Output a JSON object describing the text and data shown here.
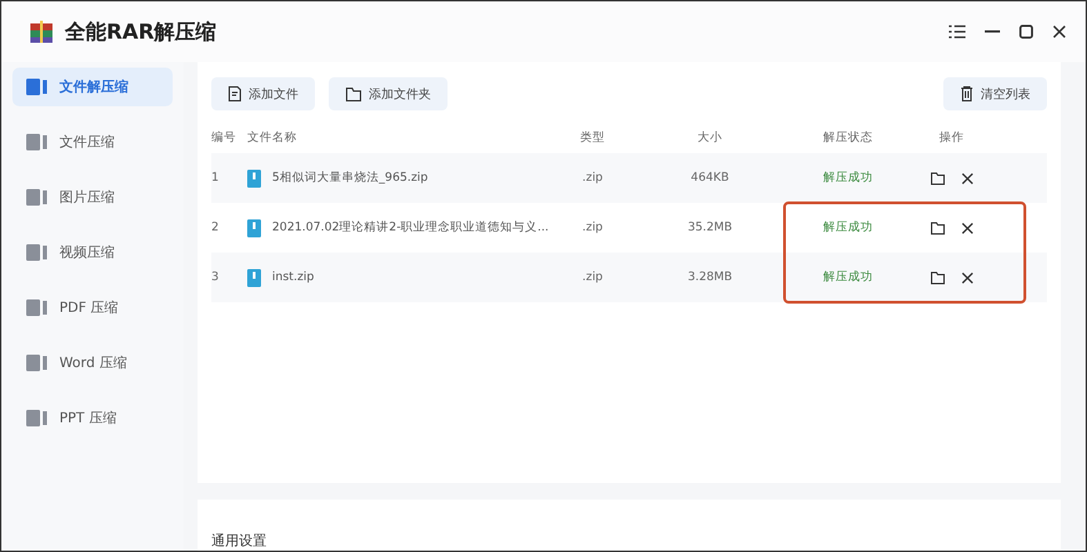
{
  "window": {
    "title": "全能RAR解压缩"
  },
  "sidebar": {
    "items": [
      {
        "label": "文件解压缩",
        "selected": true
      },
      {
        "label": "文件压缩",
        "selected": false
      },
      {
        "label": "图片压缩",
        "selected": false
      },
      {
        "label": "视频压缩",
        "selected": false
      },
      {
        "label": "PDF 压缩",
        "selected": false
      },
      {
        "label": "Word 压缩",
        "selected": false
      },
      {
        "label": "PPT 压缩",
        "selected": false
      }
    ]
  },
  "toolbar": {
    "add_file": "添加文件",
    "add_folder": "添加文件夹",
    "clear": "清空列表"
  },
  "table": {
    "columns": [
      "编号",
      "文件名称",
      "类型",
      "大小",
      "解压状态",
      "操作"
    ],
    "rows": [
      {
        "index": "1",
        "name": "5相似词大量串烧法_965.zip",
        "type": ".zip",
        "size": "464KB",
        "status": "解压成功",
        "highlighted": false
      },
      {
        "index": "2",
        "name": "2021.07.02理论精讲2-职业理念职业道德知与义...",
        "type": ".zip",
        "size": "35.2MB",
        "status": "解压成功",
        "highlighted": true
      },
      {
        "index": "3",
        "name": "inst.zip",
        "type": ".zip",
        "size": "3.28MB",
        "status": "解压成功",
        "highlighted": true
      }
    ]
  },
  "settings": {
    "title": "通用设置"
  }
}
